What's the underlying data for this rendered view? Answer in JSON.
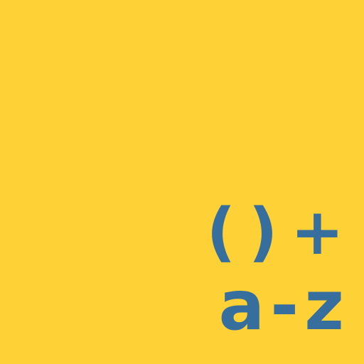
{
  "icon": {
    "background_color": "#FED136",
    "glyph_color": "#366E9D",
    "line1": "()+",
    "line2": "a-z"
  }
}
